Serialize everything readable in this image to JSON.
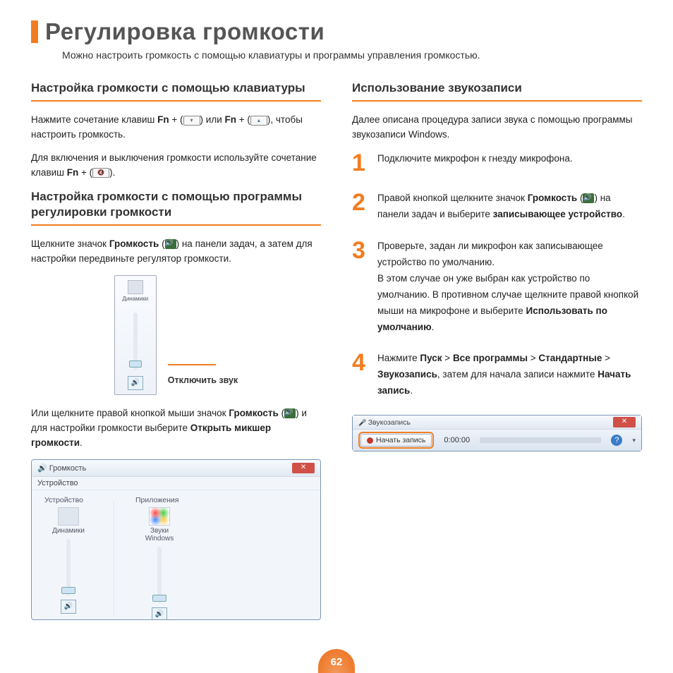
{
  "page_number": "62",
  "title": "Регулировка громкости",
  "subtitle": "Можно настроить громкость с помощью клавиатуры и программы управления громкостью.",
  "left": {
    "sec1_title": "Настройка громкости с помощью клавиатуры",
    "p1_a": "Нажмите сочетание клавиш ",
    "fn": "Fn",
    "plus": " + (",
    "or": ") или ",
    "p1_b": "), чтобы настроить громкость.",
    "p2_a": "Для включения и выключения громкости используйте сочетание клавиш ",
    "p2_b": ").",
    "sec2_title": "Настройка громкости с помощью программы регулировки громкости",
    "p3_a": "Щелкните значок ",
    "vol_word": "Громкость",
    "p3_b": " (",
    "p3_c": ") на панели задач, а затем для настройки передвиньте регулятор громкости.",
    "slider_dev": "Динамики",
    "mute_label": "Отключить звук",
    "p4_a": "Или щелкните правой кнопкой мыши значок ",
    "p4_b": " (",
    "p4_c": ") и для настройки громкости выберите ",
    "open_mixer": "Открыть микшер громкости",
    "mixer_title": "Громкость",
    "mixer_menu": "Устройство",
    "mixer_sec_device": "Устройство",
    "mixer_sec_apps": "Приложения",
    "mixer_dev_label": "Динамики",
    "mixer_app_label": "Звуки Windows"
  },
  "right": {
    "sec_title": "Использование звукозаписи",
    "intro": "Далее описана процедура записи звука с помощью программы звукозаписи Windows.",
    "steps": {
      "n1": "1",
      "s1": "Подключите микрофон к гнезду микрофона.",
      "n2": "2",
      "s2_a": "Правой кнопкой щелкните значок ",
      "s2_vol": "Громкость",
      "s2_b": " (",
      "s2_c": ") на панели задач и выберите ",
      "s2_rec": "записывающее устройство",
      "n3": "3",
      "s3_a": "Проверьте, задан ли микрофон как записывающее устройство по умолчанию.",
      "s3_b": "В этом случае он уже выбран как устройство по умолчанию. В противном случае щелкните правой кнопкой мыши на микрофоне и выберите ",
      "s3_default": "Использовать по умолчанию",
      "n4": "4",
      "s4_a": "Нажмите ",
      "s4_start": "Пуск",
      "s4_gt": " > ",
      "s4_all": "Все программы",
      "s4_std": "Стандартные",
      "s4_rec": "Звукозапись",
      "s4_b": ", затем для начала записи нажмите ",
      "s4_begin": "Начать запись"
    },
    "recorder": {
      "title": "Звукозапись",
      "btn": "Начать запись",
      "time": "0:00:00"
    }
  }
}
